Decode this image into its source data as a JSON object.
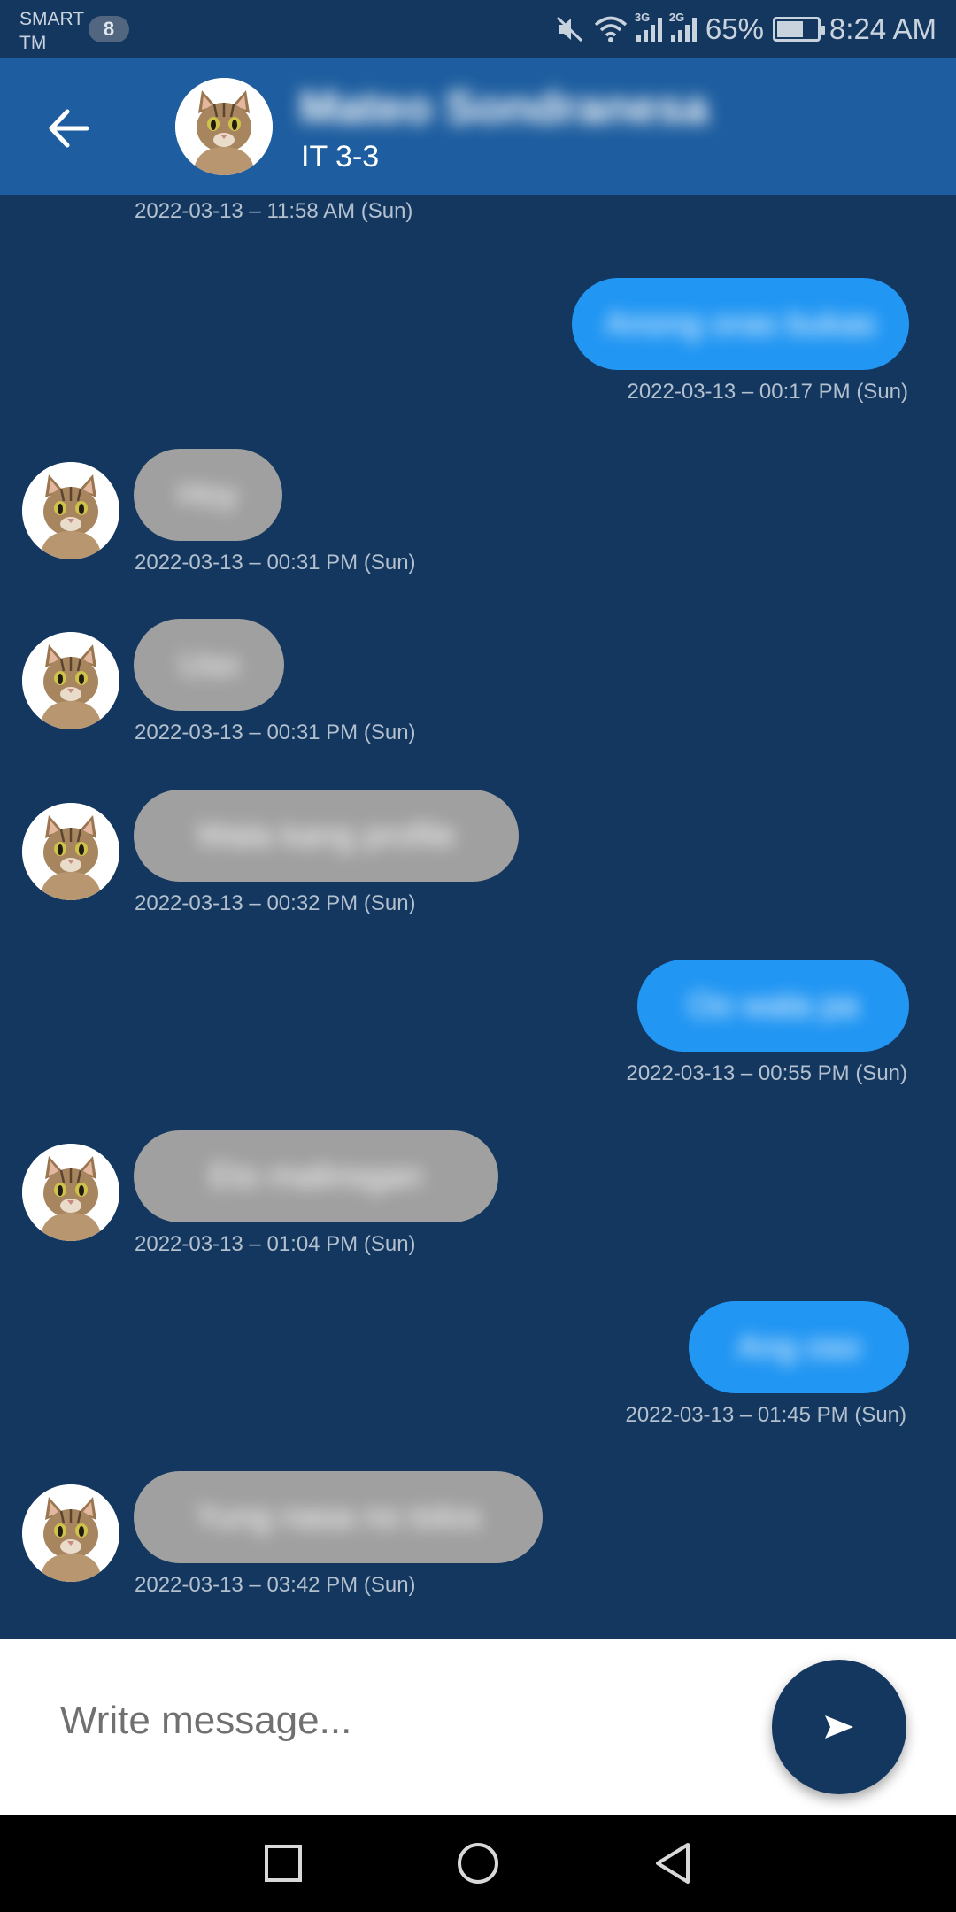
{
  "status_bar": {
    "carrier_line1": "SMART",
    "carrier_line2": "TM",
    "notification_count": "8",
    "network_1": "3G",
    "network_2": "2G",
    "battery_level": 0.65,
    "battery_percent": "65%",
    "time": "8:24 AM",
    "icons": [
      "mute-icon",
      "wifi-icon",
      "signal-icon",
      "battery-charging-icon"
    ]
  },
  "header": {
    "contact_name": "Mateo Sondranesa",
    "subtitle": "IT 3-3",
    "back_icon": "arrow-left-icon",
    "avatar_icon": "cat-avatar-icon"
  },
  "messages": [
    {
      "side": "in",
      "text": "",
      "timestamp": "2022-03-13 – 11:58 AM (Sun)"
    },
    {
      "side": "out",
      "text": "Anong oras bukas",
      "timestamp": "2022-03-13 – 00:17 PM (Sun)"
    },
    {
      "side": "in",
      "text": "Hoy",
      "timestamp": "2022-03-13 – 00:31 PM (Sun)"
    },
    {
      "side": "in",
      "text": "Uso",
      "timestamp": "2022-03-13 – 00:31 PM (Sun)"
    },
    {
      "side": "in",
      "text": "Wala kang profile",
      "timestamp": "2022-03-13 – 00:32 PM (Sun)"
    },
    {
      "side": "out",
      "text": "Oo wala pa",
      "timestamp": "2022-03-13 – 00:55 PM (Sun)"
    },
    {
      "side": "in",
      "text": "Eto malinsgan",
      "timestamp": "2022-03-13 – 01:04 PM (Sun)"
    },
    {
      "side": "out",
      "text": "Ang oso",
      "timestamp": "2022-03-13 – 01:45 PM (Sun)"
    },
    {
      "side": "in",
      "text": "Yung nasa no tolos",
      "timestamp": "2022-03-13 – 03:42 PM (Sun)"
    }
  ],
  "composer": {
    "placeholder": "Write message...",
    "value": "",
    "send_icon": "send-icon"
  },
  "nav_bar": {
    "buttons": [
      "recents-square-icon",
      "home-circle-icon",
      "back-triangle-icon"
    ]
  },
  "colors": {
    "background": "#143760",
    "app_bar": "#1e5ea0",
    "incoming_bubble": "#a0a0a0",
    "outgoing_bubble": "#2196f3",
    "timestamp": "#b3c0ce"
  }
}
